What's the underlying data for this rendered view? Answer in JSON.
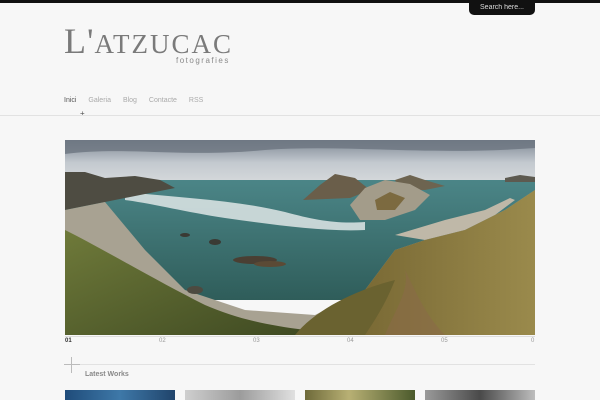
{
  "search": {
    "placeholder": "Search here..."
  },
  "logo": {
    "title_first": "L'",
    "title_rest": "atzucac",
    "subtitle": "fotografies"
  },
  "nav": {
    "items": [
      "Inici",
      "Galeria",
      "Blog",
      "Contacte",
      "RSS"
    ],
    "active": "Inici",
    "submenu_marker": "+"
  },
  "slider": {
    "slides": [
      "01",
      "02",
      "03",
      "04",
      "05",
      "0"
    ],
    "active": "01"
  },
  "latest_works": {
    "title": "Latest Works"
  },
  "colors": {
    "background": "#f7f7f7",
    "topbar": "#111111",
    "sea": "#3d6f6e",
    "grass": "#8a7a3a",
    "sky": "#c9ced4"
  }
}
